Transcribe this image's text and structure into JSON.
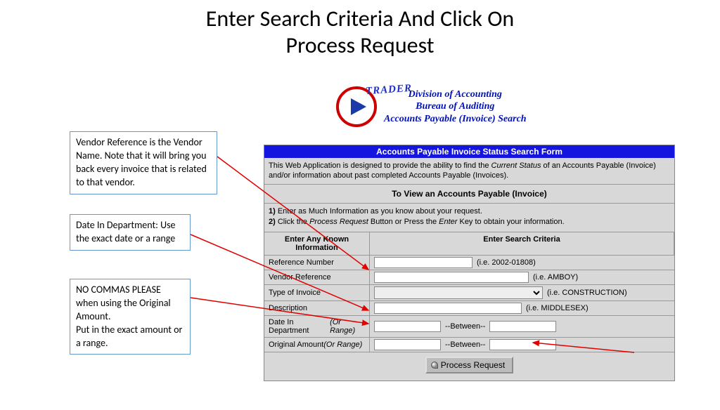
{
  "slide": {
    "title_line1": "Enter Search Criteria And Click On",
    "title_line2": "Process Request"
  },
  "callouts": {
    "c1": "Vendor Reference is the Vendor Name.   Note that it will bring you back every invoice that is related to that vendor.",
    "c2": "Date In Department: Use the exact date or a range",
    "c3": "NO COMMAS PLEASE when using the Original Amount.\nPut in the exact amount or a range."
  },
  "header": {
    "trader": "TRADER",
    "line1": "Division of Accounting",
    "line2": "Bureau of Auditing",
    "line3": "Accounts Payable (Invoice) Search"
  },
  "form": {
    "title": "Accounts Payable Invoice Status Search Form",
    "desc_a": "This Web Application is designed to provide the ability to find the ",
    "desc_b_italic": "Current Status",
    "desc_c": " of an Accounts Payable (Invoice) and/or information about past completed Accounts Payable (Invoices).",
    "sub": "To View an Accounts Payable (Invoice)",
    "step1_bold": "1)",
    "step1": " Enter as Much Information as you know about your request.",
    "step2_bold": "2)",
    "step2_a": " Click the ",
    "step2_b_italic": "Process Request",
    "step2_c": " Button or Press the ",
    "step2_d_italic": "Enter",
    "step2_e": " Key to obtain your information.",
    "col1": "Enter Any Known Information",
    "col2": "Enter Search Criteria",
    "rows": {
      "ref_label": "Reference Number",
      "ref_hint": "(i.e. 2002-01808)",
      "vendor_label": "Vendor Reference",
      "vendor_hint": "(i.e. AMBOY)",
      "type_label": "Type of Invoice",
      "type_hint": "(i.e. CONSTRUCTION)",
      "desc_label": "Description",
      "desc_hint": "(i.e. MIDDLESEX)",
      "date_label": "Date In Department ",
      "date_range": "(Or Range)",
      "amount_label": "Original Amount ",
      "amount_range": "(Or Range)",
      "between": "--Between--"
    },
    "button": "Process Request"
  }
}
